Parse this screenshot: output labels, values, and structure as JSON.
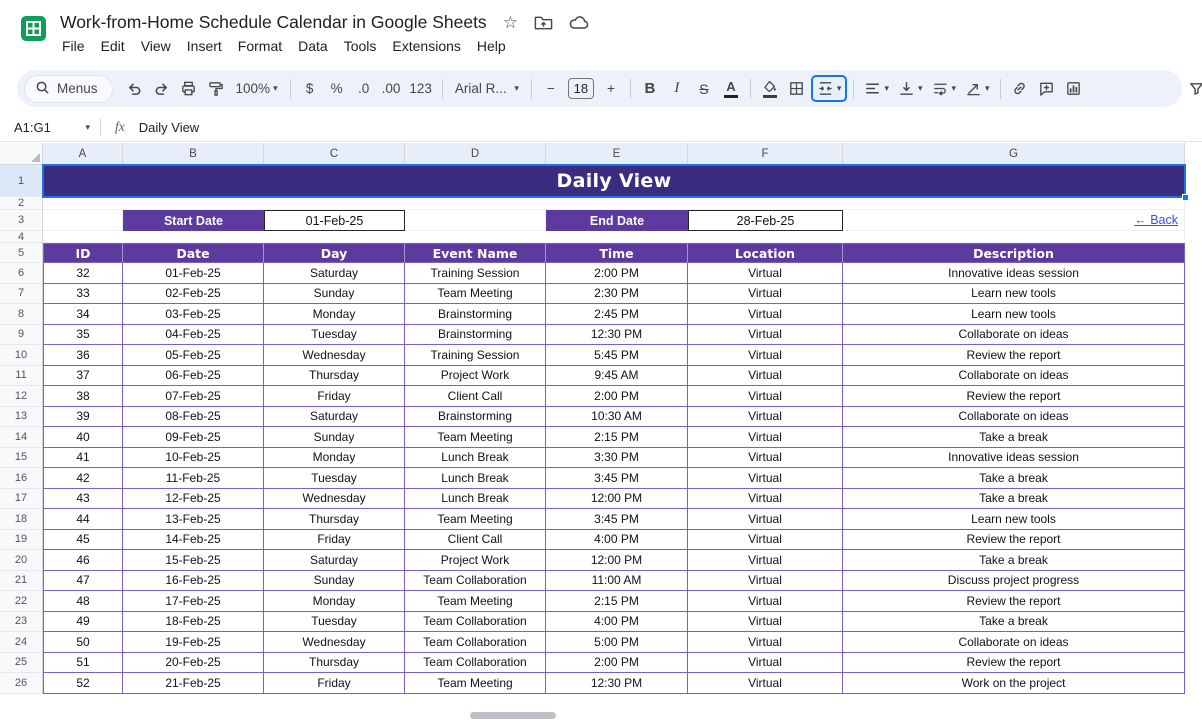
{
  "header": {
    "title": "Work-from-Home Schedule Calendar in Google Sheets",
    "star": "☆",
    "menus": [
      "File",
      "Edit",
      "View",
      "Insert",
      "Format",
      "Data",
      "Tools",
      "Extensions",
      "Help"
    ]
  },
  "toolbar": {
    "menus_label": "Menus",
    "zoom_value": "100%",
    "currency": "$",
    "percent": "%",
    "decrease_decimal": ".0",
    "increase_decimal": ".00",
    "more_formats": "123",
    "font_name": "Arial R...",
    "font_size_minus": "−",
    "font_size": "18",
    "font_size_plus": "+",
    "bold": "B",
    "italic": "I",
    "strikethrough": "S",
    "text_color": "A",
    "dropdown_glyph": "▾"
  },
  "formula_bar": {
    "name_box": "A1:G1",
    "fx": "fx",
    "content": "Daily View"
  },
  "grid": {
    "column_headers": [
      "A",
      "B",
      "C",
      "D",
      "E",
      "F",
      "G"
    ],
    "row_numbers": [
      1,
      2,
      3,
      4,
      5,
      6,
      7,
      8,
      9,
      10,
      11,
      12,
      13,
      14,
      15,
      16,
      17,
      18,
      19,
      20,
      21,
      22,
      23,
      24,
      25,
      26
    ]
  },
  "sheet_content": {
    "title": "Daily View",
    "start_date_label": "Start Date",
    "start_date_value": "01-Feb-25",
    "end_date_label": "End Date",
    "end_date_value": "28-Feb-25",
    "back_link": "← Back",
    "table": {
      "headers": [
        "ID",
        "Date",
        "Day",
        "Event Name",
        "Time",
        "Location",
        "Description"
      ],
      "rows": [
        [
          "32",
          "01-Feb-25",
          "Saturday",
          "Training Session",
          "2:00 PM",
          "Virtual",
          "Innovative ideas session"
        ],
        [
          "33",
          "02-Feb-25",
          "Sunday",
          "Team Meeting",
          "2:30 PM",
          "Virtual",
          "Learn new tools"
        ],
        [
          "34",
          "03-Feb-25",
          "Monday",
          "Brainstorming",
          "2:45 PM",
          "Virtual",
          "Learn new tools"
        ],
        [
          "35",
          "04-Feb-25",
          "Tuesday",
          "Brainstorming",
          "12:30 PM",
          "Virtual",
          "Collaborate on ideas"
        ],
        [
          "36",
          "05-Feb-25",
          "Wednesday",
          "Training Session",
          "5:45 PM",
          "Virtual",
          "Review the report"
        ],
        [
          "37",
          "06-Feb-25",
          "Thursday",
          "Project Work",
          "9:45 AM",
          "Virtual",
          "Collaborate on ideas"
        ],
        [
          "38",
          "07-Feb-25",
          "Friday",
          "Client Call",
          "2:00 PM",
          "Virtual",
          "Review the report"
        ],
        [
          "39",
          "08-Feb-25",
          "Saturday",
          "Brainstorming",
          "10:30 AM",
          "Virtual",
          "Collaborate on ideas"
        ],
        [
          "40",
          "09-Feb-25",
          "Sunday",
          "Team Meeting",
          "2:15 PM",
          "Virtual",
          "Take a break"
        ],
        [
          "41",
          "10-Feb-25",
          "Monday",
          "Lunch Break",
          "3:30 PM",
          "Virtual",
          "Innovative ideas session"
        ],
        [
          "42",
          "11-Feb-25",
          "Tuesday",
          "Lunch Break",
          "3:45 PM",
          "Virtual",
          "Take a break"
        ],
        [
          "43",
          "12-Feb-25",
          "Wednesday",
          "Lunch Break",
          "12:00 PM",
          "Virtual",
          "Take a break"
        ],
        [
          "44",
          "13-Feb-25",
          "Thursday",
          "Team Meeting",
          "3:45 PM",
          "Virtual",
          "Learn new tools"
        ],
        [
          "45",
          "14-Feb-25",
          "Friday",
          "Client Call",
          "4:00 PM",
          "Virtual",
          "Review the report"
        ],
        [
          "46",
          "15-Feb-25",
          "Saturday",
          "Project Work",
          "12:00 PM",
          "Virtual",
          "Take a break"
        ],
        [
          "47",
          "16-Feb-25",
          "Sunday",
          "Team Collaboration",
          "11:00 AM",
          "Virtual",
          "Discuss project progress"
        ],
        [
          "48",
          "17-Feb-25",
          "Monday",
          "Team Meeting",
          "2:15 PM",
          "Virtual",
          "Review the report"
        ],
        [
          "49",
          "18-Feb-25",
          "Tuesday",
          "Team Collaboration",
          "4:00 PM",
          "Virtual",
          "Take a break"
        ],
        [
          "50",
          "19-Feb-25",
          "Wednesday",
          "Team Collaboration",
          "5:00 PM",
          "Virtual",
          "Collaborate on ideas"
        ],
        [
          "51",
          "20-Feb-25",
          "Thursday",
          "Team Collaboration",
          "2:00 PM",
          "Virtual",
          "Review the report"
        ],
        [
          "52",
          "21-Feb-25",
          "Friday",
          "Team Meeting",
          "12:30 PM",
          "Virtual",
          "Work on the project"
        ]
      ]
    }
  },
  "colors": {
    "banner_bg": "#3b2c7f",
    "table_header_bg": "#5c3a9e",
    "table_border": "#7e5fc0",
    "selection_blue": "#1a73e8",
    "back_link": "#3d52c5",
    "logo_green": "#0f9d58",
    "toolbar_bg": "#edf2fa"
  }
}
